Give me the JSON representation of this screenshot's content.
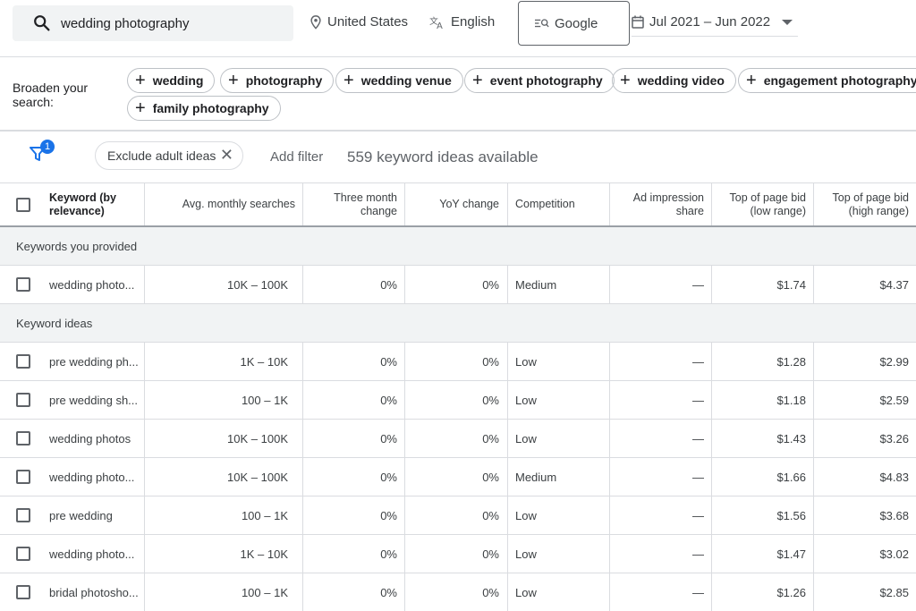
{
  "search": {
    "query": "wedding photography"
  },
  "location": "United States",
  "language": "English",
  "network": "Google",
  "date_range": "Jul 2021 – Jun 2022",
  "broaden": {
    "label": "Broaden your search:",
    "chips": [
      "wedding",
      "photography",
      "wedding venue",
      "event photography",
      "wedding video",
      "engagement photography",
      "family photography"
    ]
  },
  "filters": {
    "badge": "1",
    "exclude_chip": "Exclude adult ideas",
    "add_filter": "Add filter",
    "ideas_count": "559 keyword ideas available"
  },
  "table": {
    "headers": {
      "keyword": "Keyword (by relevance)",
      "searches": "Avg. monthly searches",
      "three_month": "Three month change",
      "yoy": "YoY change",
      "competition": "Competition",
      "impression": "Ad impression share",
      "bid_low": "Top of page bid (low range)",
      "bid_high": "Top of page bid (high range)"
    },
    "group_provided": "Keywords you provided",
    "group_ideas": "Keyword ideas",
    "provided_rows": [
      {
        "keyword": "wedding photo...",
        "searches": "10K – 100K",
        "three_month": "0%",
        "yoy": "0%",
        "competition": "Medium",
        "impression": "—",
        "bid_low": "$1.74",
        "bid_high": "$4.37"
      }
    ],
    "idea_rows": [
      {
        "keyword": "pre wedding ph...",
        "searches": "1K – 10K",
        "three_month": "0%",
        "yoy": "0%",
        "competition": "Low",
        "impression": "—",
        "bid_low": "$1.28",
        "bid_high": "$2.99"
      },
      {
        "keyword": "pre wedding sh...",
        "searches": "100 – 1K",
        "three_month": "0%",
        "yoy": "0%",
        "competition": "Low",
        "impression": "—",
        "bid_low": "$1.18",
        "bid_high": "$2.59"
      },
      {
        "keyword": "wedding photos",
        "searches": "10K – 100K",
        "three_month": "0%",
        "yoy": "0%",
        "competition": "Low",
        "impression": "—",
        "bid_low": "$1.43",
        "bid_high": "$3.26"
      },
      {
        "keyword": "wedding photo...",
        "searches": "10K – 100K",
        "three_month": "0%",
        "yoy": "0%",
        "competition": "Medium",
        "impression": "—",
        "bid_low": "$1.66",
        "bid_high": "$4.83"
      },
      {
        "keyword": "pre wedding",
        "searches": "100 – 1K",
        "three_month": "0%",
        "yoy": "0%",
        "competition": "Low",
        "impression": "—",
        "bid_low": "$1.56",
        "bid_high": "$3.68"
      },
      {
        "keyword": "wedding photo...",
        "searches": "1K – 10K",
        "three_month": "0%",
        "yoy": "0%",
        "competition": "Low",
        "impression": "—",
        "bid_low": "$1.47",
        "bid_high": "$3.02"
      },
      {
        "keyword": "bridal photosho...",
        "searches": "100 – 1K",
        "three_month": "0%",
        "yoy": "0%",
        "competition": "Low",
        "impression": "—",
        "bid_low": "$1.26",
        "bid_high": "$2.85"
      }
    ]
  },
  "icons": {
    "search": "search-icon",
    "location": "location-pin-icon",
    "language": "translate-icon",
    "network": "network-search-icon",
    "calendar": "calendar-icon",
    "filter": "filter-icon",
    "close": "close-icon",
    "plus": "plus-icon"
  }
}
